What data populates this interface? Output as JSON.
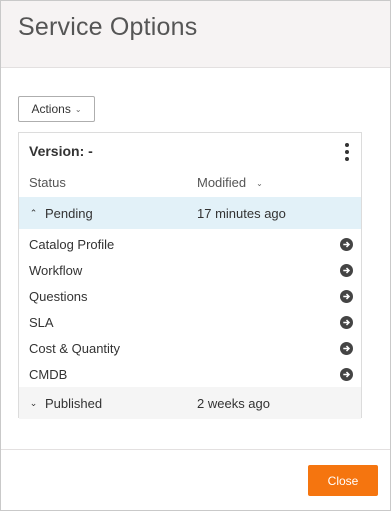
{
  "dialog": {
    "title": "Service Options",
    "actions_label": "Actions",
    "close_label": "Close"
  },
  "panel": {
    "version_label": "Version: -",
    "columns": {
      "status": "Status",
      "modified": "Modified"
    },
    "pending": {
      "label": "Pending",
      "modified": "17 minutes ago",
      "expanded": true
    },
    "items": [
      {
        "label": "Catalog Profile"
      },
      {
        "label": "Workflow"
      },
      {
        "label": "Questions"
      },
      {
        "label": "SLA"
      },
      {
        "label": "Cost & Quantity"
      },
      {
        "label": "CMDB"
      }
    ],
    "published": {
      "label": "Published",
      "modified": "2 weeks ago",
      "expanded": false
    }
  },
  "colors": {
    "accent": "#f5750f",
    "pending_row_bg": "#e2f1f8",
    "header_bg": "#f6f3f3"
  },
  "icons": {
    "actions_caret": "chevron-down-icon",
    "more": "kebab-menu-icon",
    "item_nav": "arrow-circle-right-icon"
  }
}
